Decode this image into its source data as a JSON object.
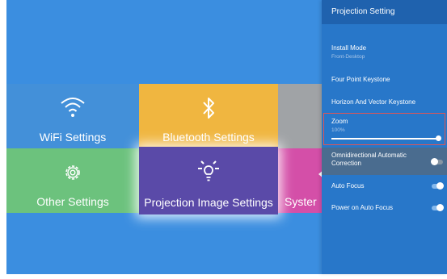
{
  "tiles": {
    "wifi": {
      "label": "WiFi Settings",
      "icon": "wifi-icon"
    },
    "bluetooth": {
      "label": "Bluetooth Settings",
      "icon": "bluetooth-icon"
    },
    "other": {
      "label": "Other Settings",
      "icon": "gear-icon"
    },
    "projection": {
      "label": "Projection Image Settings",
      "icon": "bulb-icon"
    },
    "system": {
      "label": "Syster",
      "icon": "arrow-up-icon"
    }
  },
  "panel": {
    "title": "Projection Setting",
    "install_mode": {
      "label": "Install Mode",
      "value": "Front-Desktop"
    },
    "four_point": "Four Point Keystone",
    "horizon": "Horizon And Vector Keystone",
    "zoom": {
      "label": "Zoom",
      "value": "100%",
      "level": 1.0
    },
    "omni": {
      "label": "Omnidirectional Automatic Correction",
      "enabled": false
    },
    "auto_focus": {
      "label": "Auto Focus",
      "enabled": true
    },
    "power_on_focus": {
      "label": "Power on Auto Focus",
      "enabled": true
    }
  },
  "colors": {
    "background": "#3b8ee0",
    "panel": "#2877c9",
    "panel_header": "#1f62ae",
    "wifi": "#4390d9",
    "bluetooth": "#f0b640",
    "other": "#6cc27d",
    "projection": "#5a4aa8",
    "system": "#d44fa8",
    "zoom_highlight": "#e05555"
  }
}
